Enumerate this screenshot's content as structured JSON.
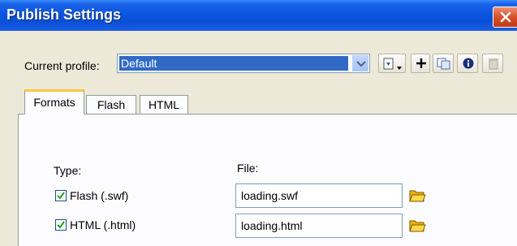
{
  "window": {
    "title": "Publish Settings"
  },
  "profile": {
    "label": "Current profile:",
    "value": "Default"
  },
  "toolbar": {
    "icons": [
      "import-export-icon",
      "add-profile-icon",
      "duplicate-profile-icon",
      "profile-info-icon",
      "delete-profile-icon"
    ]
  },
  "tabs": [
    {
      "label": "Formats",
      "active": true
    },
    {
      "label": "Flash",
      "active": false
    },
    {
      "label": "HTML",
      "active": false
    }
  ],
  "formats": {
    "type_header": "Type:",
    "file_header": "File:",
    "rows": [
      {
        "label": "Flash (.swf)",
        "checked": true,
        "file": "loading.swf"
      },
      {
        "label": "HTML (.html)",
        "checked": true,
        "file": "loading.html"
      }
    ]
  },
  "colors": {
    "title_bar": "#0a55e0",
    "selection": "#316ac5",
    "active_tab_accent": "#ffc73c",
    "dialog_bg": "#ece9d8"
  }
}
